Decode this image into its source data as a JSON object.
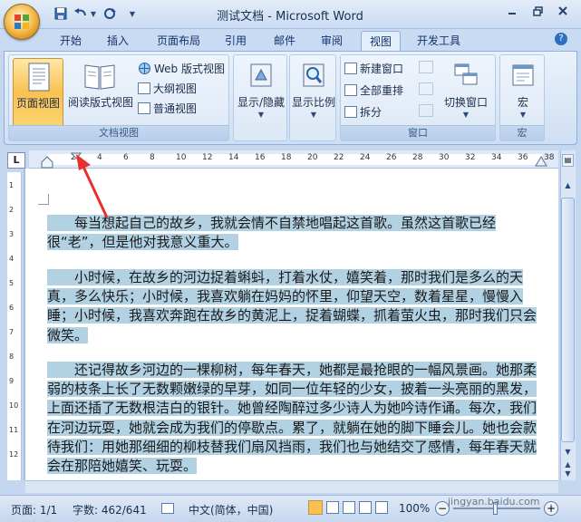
{
  "window": {
    "title": "测试文档 - Microsoft Word"
  },
  "tabs": [
    "开始",
    "插入",
    "页面布局",
    "引用",
    "邮件",
    "审阅",
    "视图",
    "开发工具"
  ],
  "active_tab": "视图",
  "ribbon": {
    "doc_views": {
      "label": "文档视图",
      "print_layout": "页面视图",
      "reading": "阅读版式视图",
      "web_layout": "Web 版式视图",
      "outline": "大纲视图",
      "draft": "普通视图"
    },
    "show_hide": {
      "label": "显示/隐藏"
    },
    "zoom": {
      "label": "显示比例"
    },
    "window": {
      "label": "窗口",
      "new_window": "新建窗口",
      "arrange_all": "全部重排",
      "split": "拆分",
      "switch_windows": "切换窗口"
    },
    "macros": {
      "label": "宏",
      "macros_btn": "宏"
    }
  },
  "ruler": {
    "marks": [
      "2",
      "4",
      "6",
      "8",
      "10",
      "12",
      "14",
      "16",
      "18",
      "20",
      "22",
      "24",
      "26",
      "28",
      "30",
      "32",
      "34",
      "36",
      "38"
    ],
    "corner": "L"
  },
  "vruler_marks": [
    "1",
    "2",
    "3",
    "4",
    "5",
    "6",
    "7",
    "8",
    "9",
    "10",
    "11",
    "12"
  ],
  "document": {
    "paragraphs": [
      "　　每当想起自己的故乡，我就会情不自禁地唱起这首歌。虽然这首歌已经很“老”，但是他对我意义重大。",
      "　　小时候，在故乡的河边捉着蝌蚪，打着水仗，嬉笑着，那时我们是多么的天真，多么快乐；小时候，我喜欢躺在妈妈的怀里，仰望天空，数着星星，慢慢入睡；小时候，我喜欢奔跑在故乡的黄泥上，捉着蝴蝶，抓着萤火虫，那时我们只会微笑。",
      "　　还记得故乡河边的一棵柳树，每年春天，她都是最抢眼的一幅风景画。她那柔弱的枝条上长了无数颗嫩绿的早芽，如同一位年轻的少女，披着一头亮丽的黑发，上面还插了无数根洁白的银针。她曾经陶醉过多少诗人为她吟诗作诵。每次，我们在河边玩耍，她就会成为我们的停歇点。累了，就躺在她的脚下睡会儿。她也会款待我们：用她那细细的柳枝替我们扇风挡雨，我们也与她结交了感情，每年春天就会在那陪她嬉笑、玩耍。"
    ]
  },
  "statusbar": {
    "page": "页面: 1/1",
    "words": "字数: 462/641",
    "language": "中文(简体，中国)",
    "zoom": "100%",
    "watermark": "jingyan.baidu.com"
  },
  "colors": {
    "highlight": "#b2d2e4",
    "arrow": "#e8302c"
  }
}
